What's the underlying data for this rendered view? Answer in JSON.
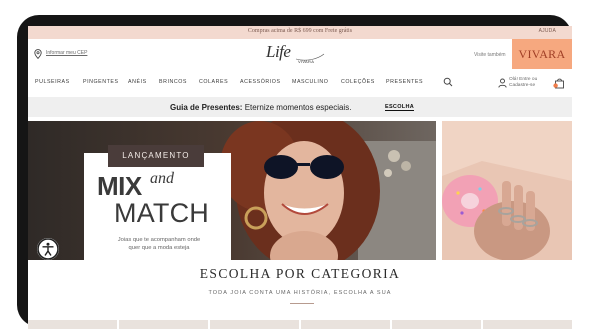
{
  "promo_bar": {
    "text": "Compras acima de R$ 699 com Frete grátis",
    "help_link": "AJUDA"
  },
  "header": {
    "location_link": "Informar meu CEP",
    "logo_text": "Life",
    "logo_sub": "VIVARA",
    "visit_text": "Visite também",
    "partner_brand": "VIVARA"
  },
  "nav": {
    "items": [
      "PULSEIRAS",
      "PINGENTES",
      "ANÉIS",
      "BRINCOS",
      "COLARES",
      "ACESSÓRIOS",
      "MASCULINO",
      "COLEÇÕES",
      "PRESENTES"
    ],
    "login_line1": "Olá! Entre ou",
    "login_line2": "Cadastre-se"
  },
  "gift_banner": {
    "bold": "Guia de Presentes:",
    "text": " Eternize momentos especiais.",
    "link": "ESCOLHA"
  },
  "hero": {
    "tag": "LANÇAMENTO",
    "title_mix": "MIX",
    "title_and": "and",
    "title_match": "MATCH",
    "subtitle_line1": "Joias que te acompanham onde",
    "subtitle_line2": "quer que a moda esteja"
  },
  "category": {
    "title": "ESCOLHA POR CATEGORIA",
    "subtitle": "TODA JOIA CONTA UMA HISTÓRIA, ESCOLHA A SUA"
  },
  "colors": {
    "promo_bg": "#f3d9cf",
    "accent": "#f6a87f",
    "tag_bg": "#4a3c3a"
  }
}
